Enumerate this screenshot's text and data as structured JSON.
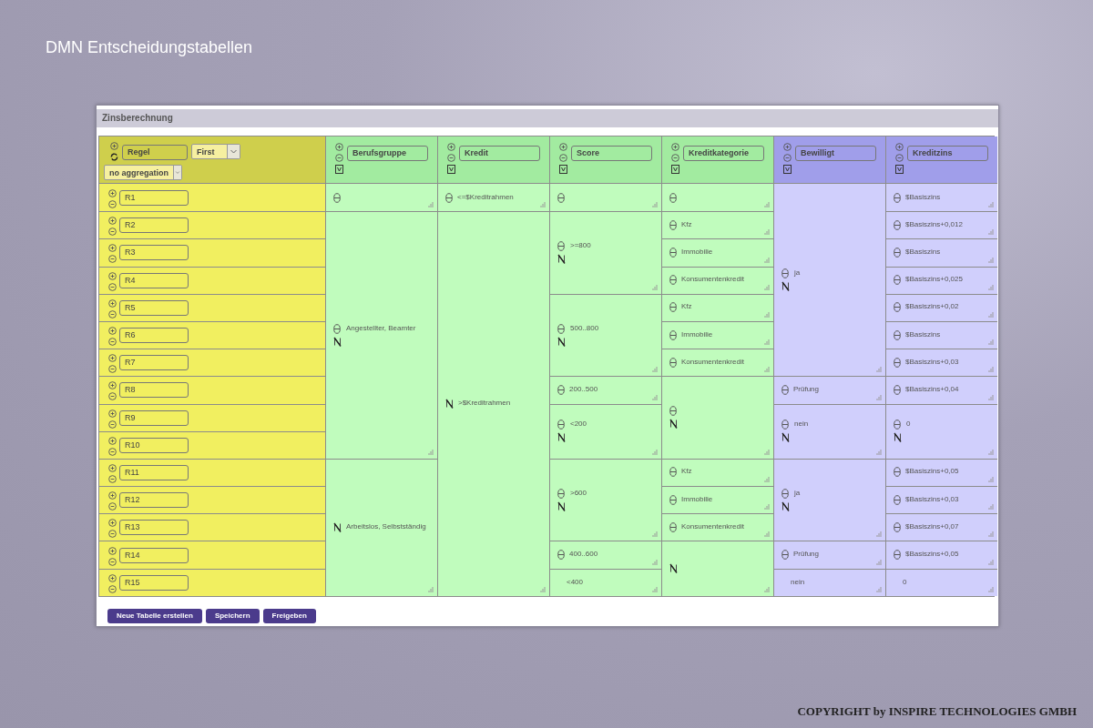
{
  "page_title": "DMN Entscheidungstabellen",
  "panel": {
    "title": "Zinsberechnung",
    "rule_header": {
      "name": "Regel",
      "hit_policy": "First",
      "aggregation": "no aggregation"
    },
    "rules": [
      "R1",
      "R2",
      "R3",
      "R4",
      "R5",
      "R6",
      "R7",
      "R8",
      "R9",
      "R10",
      "R11",
      "R12",
      "R13",
      "R14",
      "R15"
    ],
    "columns": [
      {
        "name": "Berufsgruppe",
        "kind": "input",
        "cells": [
          {
            "kind": "expr"
          },
          {
            "kind": "expr_negate",
            "text": "Angestellter, Beamter"
          },
          {
            "merged": true
          },
          {
            "merged": true
          },
          {
            "merged": true
          },
          {
            "merged": true
          },
          {
            "merged": true
          },
          {
            "merged": true
          },
          {
            "merged": true
          },
          {
            "merged": true
          },
          {
            "kind": "negate",
            "text": "Arbeitslos, Selbstständig"
          },
          {
            "merged": true
          },
          {
            "merged": true
          },
          {
            "merged": true
          },
          {
            "merged": true
          }
        ]
      },
      {
        "name": "Kredit",
        "kind": "input",
        "cells": [
          {
            "kind": "expr",
            "text": "<=$Kreditrahmen"
          },
          {
            "kind": "negate",
            "text": ">$Kreditrahmen"
          },
          {
            "merged": true
          },
          {
            "merged": true
          },
          {
            "merged": true
          },
          {
            "merged": true
          },
          {
            "merged": true
          },
          {
            "merged": true
          },
          {
            "merged": true
          },
          {
            "merged": true
          },
          {
            "merged": true
          },
          {
            "merged": true
          },
          {
            "merged": true
          },
          {
            "merged": true
          },
          {
            "merged": true
          }
        ]
      },
      {
        "name": "Score",
        "kind": "input",
        "cells": [
          {
            "kind": "expr"
          },
          {
            "kind": "expr_negate",
            "text": ">=800"
          },
          {
            "merged": true
          },
          {
            "merged": true
          },
          {
            "kind": "expr_negate",
            "text": "500..800"
          },
          {
            "merged": true
          },
          {
            "merged": true
          },
          {
            "kind": "expr",
            "text": "200..500"
          },
          {
            "kind": "expr_negate",
            "text": "<200"
          },
          {
            "merged": true
          },
          {
            "kind": "expr_negate",
            "text": ">600"
          },
          {
            "merged": true
          },
          {
            "merged": true
          },
          {
            "kind": "expr",
            "text": "400..600"
          },
          {
            "kind": "plain",
            "text": "<400"
          }
        ]
      },
      {
        "name": "Kreditkategorie",
        "kind": "input",
        "cells": [
          {
            "kind": "expr"
          },
          {
            "kind": "expr",
            "text": "Kfz"
          },
          {
            "kind": "expr",
            "text": "Immobilie"
          },
          {
            "kind": "expr",
            "text": "Konsumentenkredit"
          },
          {
            "kind": "expr",
            "text": "Kfz"
          },
          {
            "kind": "expr",
            "text": "Immobilie"
          },
          {
            "kind": "expr",
            "text": "Konsumentenkredit"
          },
          {
            "kind": "expr_negate"
          },
          {
            "merged": true
          },
          {
            "merged": true
          },
          {
            "kind": "expr",
            "text": "Kfz"
          },
          {
            "kind": "expr",
            "text": "Immobilie"
          },
          {
            "kind": "expr",
            "text": "Konsumentenkredit"
          },
          {
            "kind": "negate"
          },
          {
            "merged": true
          }
        ]
      },
      {
        "name": "Bewilligt",
        "kind": "output",
        "cells": [
          {
            "kind": "expr_negate",
            "text": "ja"
          },
          {
            "merged": true
          },
          {
            "merged": true
          },
          {
            "merged": true
          },
          {
            "merged": true
          },
          {
            "merged": true
          },
          {
            "merged": true
          },
          {
            "kind": "expr",
            "text": "Prüfung"
          },
          {
            "kind": "expr_negate",
            "text": "nein"
          },
          {
            "merged": true
          },
          {
            "kind": "expr_negate",
            "text": "ja"
          },
          {
            "merged": true
          },
          {
            "merged": true
          },
          {
            "kind": "expr",
            "text": "Prüfung"
          },
          {
            "kind": "plain",
            "text": "nein"
          }
        ]
      },
      {
        "name": "Kreditzins",
        "kind": "output",
        "cells": [
          {
            "kind": "expr",
            "text": "$Basiszins"
          },
          {
            "kind": "expr",
            "text": "$Basiszins+0,012"
          },
          {
            "kind": "expr",
            "text": "$Basiszins"
          },
          {
            "kind": "expr",
            "text": "$Basiszins+0,025"
          },
          {
            "kind": "expr",
            "text": "$Basiszins+0,02"
          },
          {
            "kind": "expr",
            "text": "$Basiszins"
          },
          {
            "kind": "expr",
            "text": "$Basiszins+0,03"
          },
          {
            "kind": "expr",
            "text": "$Basiszins+0,04"
          },
          {
            "kind": "expr_negate",
            "text": "0"
          },
          {
            "merged": true
          },
          {
            "kind": "expr",
            "text": "$Basiszins+0,05"
          },
          {
            "kind": "expr",
            "text": "$Basiszins+0,03"
          },
          {
            "kind": "expr",
            "text": "$Basiszins+0,07"
          },
          {
            "kind": "expr",
            "text": "$Basiszins+0,05"
          },
          {
            "kind": "plain",
            "text": "0"
          }
        ]
      }
    ],
    "buttons": [
      "Neue Tabelle erstellen",
      "Speichern",
      "Freigeben"
    ]
  },
  "copyright": "COPYRIGHT by INSPIRE TECHNOLOGIES GMBH"
}
